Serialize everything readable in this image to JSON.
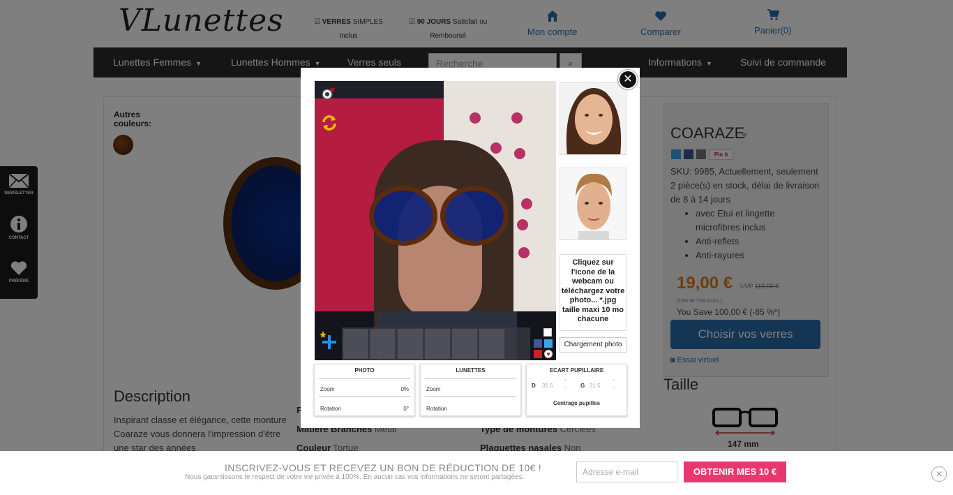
{
  "header": {
    "logo": "VLunettes",
    "usp1_strong": "VERRES",
    "usp1_rest": " SIMPLES",
    "usp1_line2": "Inclus",
    "usp2_strong": "90 JOURS",
    "usp2_rest": " Satisfait ou",
    "usp2_line2": "Remboursé",
    "account": "Mon compte",
    "compare": "Comparer",
    "cart": "Panier(0)"
  },
  "nav": {
    "women": "Lunettes Femmes",
    "men": "Lunettes Hommes",
    "lenses": "Verres seuls",
    "search_placeholder": "Recherche",
    "info": "Informations",
    "tracking": "Suivi de commande"
  },
  "sidebar": {
    "newsletter": "NEWSLETTER",
    "contact": "CONTACT",
    "favorite": "PRÉFÉRÉ"
  },
  "product": {
    "other_colors_1": "Autres",
    "other_colors_2": "couleurs:",
    "name": "COARAZE",
    "pinit": "Pin it",
    "sku": "SKU: 9985, Actuellement, seulement 2 pièce(s) en stock, délai de livraison de 8 à 14 jours",
    "features": [
      "avec Etui et lingette microfibres inclus",
      "Anti-reflets",
      "Anti-rayures"
    ],
    "price": "19,00 €",
    "uvp_label": "UVP ",
    "uvp_price": "119,00 €",
    "tva": "(19% de TVA inclus.)",
    "save": "You Save 100,00 € (-85 %*)",
    "choose_btn": "Choisir vos verres",
    "essai": "Essai virtuel",
    "taille": "Taille",
    "size_mm": "147 mm"
  },
  "description": {
    "title": "Description",
    "text": "Inspirant classe et élégance, cette monture Coaraze vous donnera l'impression d'être une star des années",
    "spec1_label": "Matière Branches",
    "spec1_value": " Métal",
    "spec2_label": "Couleur",
    "spec2_value": " Tortue",
    "spec3_label": "Type de montures",
    "spec3_value": " Cerclées",
    "spec4_label": "Plaquettes nasales",
    "spec4_value": " Non",
    "spec_partial": "F"
  },
  "modal": {
    "help_text": "Cliquez sur l'icone de la webcam ou téléchargez votre photo... *.jpg taille maxi 10 mo chacune",
    "upload_btn": "Chargement photo",
    "close": "✕",
    "photo_panel": {
      "title": "PHOTO",
      "zoom_label": "Zoom",
      "zoom_value": "0%",
      "rotation_label": "Rotation",
      "rotation_value": "0°"
    },
    "glasses_panel": {
      "title": "LUNETTES",
      "zoom_label": "Zoom",
      "rotation_label": "Rotation"
    },
    "pd_panel": {
      "title": "ECART PUPILLAIRE",
      "d_label": "D",
      "d_value": "31.5",
      "g_label": "G",
      "g_value": "31.5",
      "center_btn": "Centrage pupilles"
    }
  },
  "newsletter": {
    "title": "INSCRIVEZ-VOUS ET RECEVEZ UN BON DE RÉDUCTION DE 10€ !",
    "subtitle": "Nous garantissons le respect de votre vie privée à 100%. En aucun cas vos informations ne seront partagées.",
    "email_placeholder": "Adresse e-mail",
    "button": "OBTENIR MES 10 €"
  },
  "colors": {
    "brand_blue": "#2a6ba8",
    "price_orange": "#e07a10",
    "cta_pink": "#e8386d",
    "nav_dark": "#2b2b2b"
  }
}
